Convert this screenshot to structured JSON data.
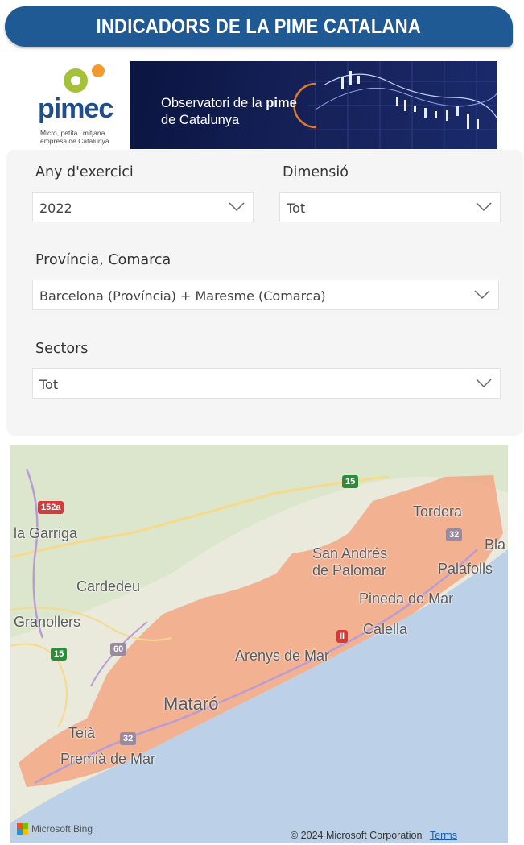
{
  "header": {
    "title": "INDICADORS DE LA PIME CATALANA"
  },
  "logo": {
    "name": "pimec",
    "tagline": "Micro, petita i mitjana empresa de Catalunya"
  },
  "banner": {
    "line1_prefix": "Observatori de la",
    "line1_highlight": "pime",
    "line2": "de Catalunya"
  },
  "filters": {
    "year": {
      "label": "Any d'exercici",
      "value": "2022"
    },
    "dimension": {
      "label": "Dimensió",
      "value": "Tot"
    },
    "region": {
      "label": "Província, Comarca",
      "value": "Barcelona (Província) + Maresme (Comarca)"
    },
    "sectors": {
      "label": "Sectors",
      "value": "Tot"
    }
  },
  "map": {
    "place_labels": {
      "la_garriga": "la Garriga",
      "cardedeu": "Cardedeu",
      "granollers": "Granollers",
      "tordera": "Tordera",
      "bla": "Bla",
      "san_andres": "San Andrés",
      "de_palomar": "de Palomar",
      "palafolls": "Palafolls",
      "pineda": "Pineda de Mar",
      "calella": "Calella",
      "arenys": "Arenys de Mar",
      "mataro": "Mataró",
      "teia": "Teià",
      "premia": "Premià de Mar"
    },
    "road_shields": {
      "c152a": "152a",
      "ap7": "15",
      "c60": "60",
      "c15b": "15",
      "c32a": "32",
      "c32b": "32",
      "n2": "II"
    },
    "attribution": {
      "provider": "Microsoft Bing",
      "copyright": "© 2024 Microsoft Corporation",
      "terms": "Terms"
    },
    "colors": {
      "land": "#e9eadc",
      "sea": "#bcd1e8",
      "highlight": "#f4a27e"
    }
  }
}
